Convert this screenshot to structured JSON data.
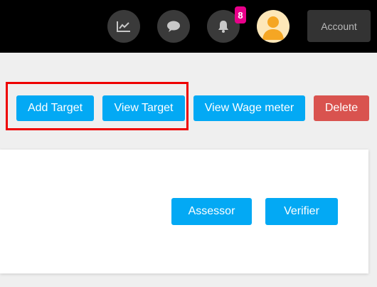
{
  "topbar": {
    "icons": {
      "chart": "chart-line-icon",
      "chat": "chat-bubble-icon",
      "bell": "bell-icon"
    },
    "notification_count": "8",
    "account_label": "Account",
    "colors": {
      "background": "#000000",
      "badge": "#e8008a"
    }
  },
  "toolbar": {
    "add_target": "Add Target",
    "view_target": "View Target",
    "view_wage_meter": "View Wage meter",
    "delete": "Delete"
  },
  "card": {
    "assessor": "Assessor",
    "verifier": "Verifier"
  },
  "colors": {
    "primary": "#03a9f4",
    "danger": "#d9534f",
    "highlight": "#ee0000"
  }
}
